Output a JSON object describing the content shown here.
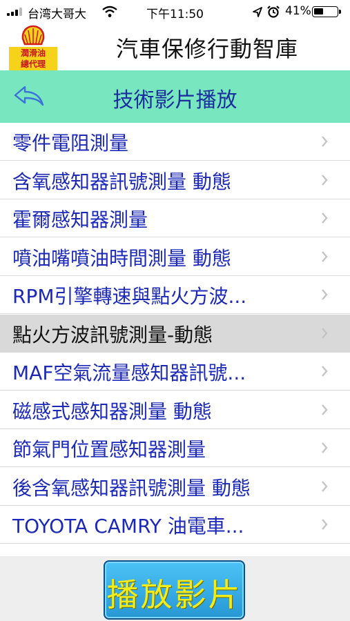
{
  "status_bar": {
    "carrier": "台湾大哥大",
    "time": "下午11:50",
    "battery": "41%",
    "battery_level": 0.41,
    "icons": [
      "signal-icon",
      "wifi-icon",
      "location-icon",
      "alarm-icon",
      "battery-icon"
    ]
  },
  "header": {
    "logo_text_line1": "潤滑油",
    "logo_text_line2": "總代理",
    "app_title": "汽車保修行動智庫",
    "logo_icon": "shell-logo-icon"
  },
  "navbar": {
    "title": "技術影片播放",
    "back_icon": "back-arrow-icon",
    "background": "#78e6bf"
  },
  "list": {
    "items": [
      {
        "label": "零件電阻測量"
      },
      {
        "label": "含氧感知器訊號測量 動態"
      },
      {
        "label": "霍爾感知器測量"
      },
      {
        "label": "噴油嘴噴油時間測量 動態"
      },
      {
        "label": "RPM引擎轉速與點火方波..."
      },
      {
        "label": "點火方波訊號測量-動態",
        "selected": true
      },
      {
        "label": "MAF空氣流量感知器訊號..."
      },
      {
        "label": "磁感式感知器測量 動態"
      },
      {
        "label": "節氣門位置感知器測量"
      },
      {
        "label": "後含氧感知器訊號測量 動態"
      },
      {
        "label": "TOYOTA CAMRY 油電車..."
      }
    ],
    "item_color": "#1c29b8"
  },
  "footer": {
    "play_label": "播放影片"
  }
}
